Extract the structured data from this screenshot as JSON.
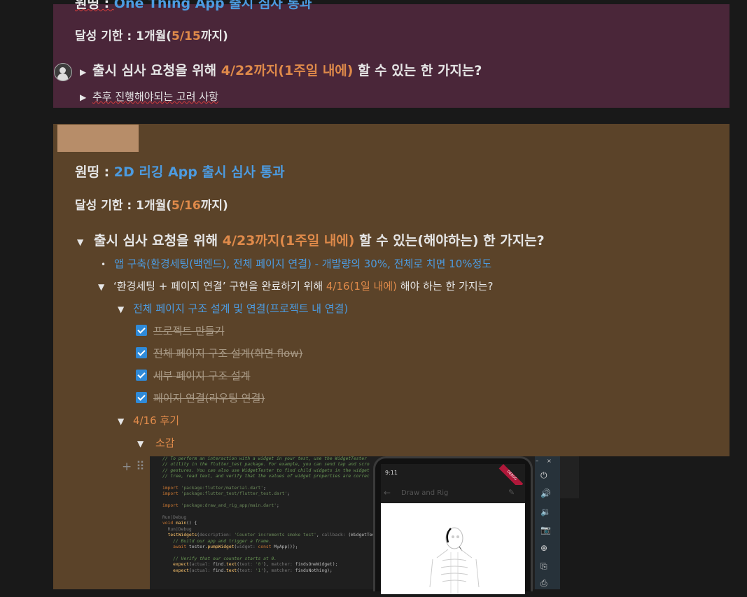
{
  "block1": {
    "goal_label": "원띵 : ",
    "goal_value": "One Thing App 출시 심사 통과",
    "deadline_label": "달성 기한 : 1개월(",
    "deadline_value": "5/15",
    "deadline_suffix": "까지)",
    "toggle_q_prefix": "출시 심사 요청을 위해 ",
    "toggle_q_highlight": "4/22까지(1주일 내에)",
    "toggle_q_suffix": " 할 수 있는 한 가지는?",
    "toggle_note": "추후 진행해야되는 고려 사항"
  },
  "block2": {
    "goal_label": "원띵 : ",
    "goal_value": "2D 리깅 App 출시 심사 통과",
    "deadline_label": "달성 기한 : 1개월(",
    "deadline_value": "5/16",
    "deadline_suffix": "까지)",
    "question_prefix": "출시 심사 요청을 위해 ",
    "question_highlight": "4/23까지(1주일 내에)",
    "question_suffix": " 할 수 있는(해야하는) 한 가지는?",
    "bullet_text": "앱 구축(환경세팅(백엔드), 전체 페이지 연결) - 개발량의 30%, 전체로 치면 10%정도",
    "sub_q_prefix": "‘환경세팅 + 페이지 연결’ 구현을 완료하기 위해 ",
    "sub_q_highlight": "4/16(1일 내에)",
    "sub_q_suffix": " 해야 하는 한 가지는?",
    "task_group": "전체 페이지 구조 설계 및 연결(프로젝트 내 연결)",
    "tasks": [
      "프로젝트 만들기",
      "전체 페이지 구조 설계(화면 flow)",
      "세부 페이지 구조 설계",
      "페이지 연결(라우팅 연결)"
    ],
    "review_title": "4/16 후기",
    "impression_title": "소감"
  },
  "screenshot": {
    "phone_time": "9:11",
    "app_title": "Draw and Rig",
    "debug_label": "DEBUG"
  }
}
